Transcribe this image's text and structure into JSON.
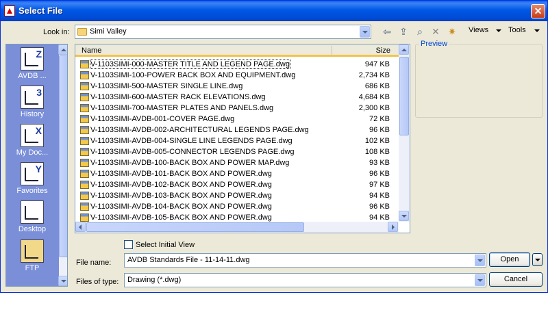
{
  "window": {
    "title": "Select File"
  },
  "look_in": {
    "label": "Look in:",
    "value": "Simi Valley"
  },
  "toolbar": {
    "back_icon": "back-arrow-icon",
    "up_icon": "up-folder-icon",
    "search_icon": "search-web-icon",
    "delete_icon": "delete-icon",
    "new_folder_icon": "new-folder-icon",
    "views_label": "Views",
    "tools_label": "Tools"
  },
  "places": [
    {
      "label": "AVDB ...",
      "icon": "avdb-icon",
      "glyph": "Z"
    },
    {
      "label": "History",
      "icon": "history-icon",
      "glyph": "3"
    },
    {
      "label": "My Doc...",
      "icon": "my-documents-icon",
      "glyph": "X"
    },
    {
      "label": "Favorites",
      "icon": "favorites-icon",
      "glyph": "Y"
    },
    {
      "label": "Desktop",
      "icon": "desktop-icon",
      "glyph": ""
    },
    {
      "label": "FTP",
      "icon": "ftp-icon",
      "glyph": ""
    }
  ],
  "file_list": {
    "columns": {
      "name": "Name",
      "size": "Size"
    },
    "rows": [
      {
        "name": "V-1103SIMI-000-MASTER TITLE AND LEGEND PAGE.dwg",
        "size": "947 KB"
      },
      {
        "name": "V-1103SIMI-100-POWER BACK BOX AND EQUIPMENT.dwg",
        "size": "2,734 KB"
      },
      {
        "name": "V-1103SIMI-500-MASTER SINGLE LINE.dwg",
        "size": "686 KB"
      },
      {
        "name": "V-1103SIMI-600-MASTER RACK ELEVATIONS.dwg",
        "size": "4,684 KB"
      },
      {
        "name": "V-1103SIMI-700-MASTER PLATES AND PANELS.dwg",
        "size": "2,300 KB"
      },
      {
        "name": "V-1103SIMI-AVDB-001-COVER PAGE.dwg",
        "size": "72 KB"
      },
      {
        "name": "V-1103SIMI-AVDB-002-ARCHITECTURAL LEGENDS PAGE.dwg",
        "size": "96 KB"
      },
      {
        "name": "V-1103SIMI-AVDB-004-SINGLE LINE LEGENDS PAGE.dwg",
        "size": "102 KB"
      },
      {
        "name": "V-1103SIMI-AVDB-005-CONNECTOR LEGENDS PAGE.dwg",
        "size": "108 KB"
      },
      {
        "name": "V-1103SIMI-AVDB-100-BACK BOX AND POWER MAP.dwg",
        "size": "93 KB"
      },
      {
        "name": "V-1103SIMI-AVDB-101-BACK BOX AND POWER.dwg",
        "size": "96 KB"
      },
      {
        "name": "V-1103SIMI-AVDB-102-BACK BOX AND POWER.dwg",
        "size": "97 KB"
      },
      {
        "name": "V-1103SIMI-AVDB-103-BACK BOX AND POWER.dwg",
        "size": "94 KB"
      },
      {
        "name": "V-1103SIMI-AVDB-104-BACK BOX AND POWER.dwg",
        "size": "96 KB"
      },
      {
        "name": "V-1103SIMI-AVDB-105-BACK BOX AND POWER.dwg",
        "size": "94 KB"
      }
    ]
  },
  "preview": {
    "label": "Preview"
  },
  "select_initial_view": {
    "label": "Select Initial View",
    "checked": false
  },
  "file_name": {
    "label": "File name:",
    "value": "AVDB Standards File - 11-14-11.dwg"
  },
  "files_of_type": {
    "label": "Files of type:",
    "value": "Drawing (*.dwg)"
  },
  "buttons": {
    "open": "Open",
    "cancel": "Cancel"
  }
}
